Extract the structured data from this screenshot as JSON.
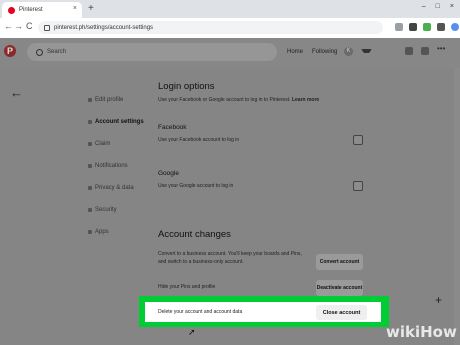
{
  "browser": {
    "tab_title": "Pinterest",
    "tab_close": "×",
    "new_tab": "+",
    "window_controls": [
      "–",
      "□",
      "×"
    ],
    "url": "pinterest.ph/settings/account-settings",
    "nav": {
      "back": "←",
      "forward": "→",
      "reload": "C"
    }
  },
  "header": {
    "logo": "P",
    "search_placeholder": "Search",
    "nav": [
      "Home",
      "Following"
    ],
    "avatar_letter": "K"
  },
  "back_arrow": "←",
  "sidebar": {
    "items": [
      {
        "label": "Edit profile",
        "icon": "pencil-icon"
      },
      {
        "label": "Account settings",
        "icon": "gear-icon"
      },
      {
        "label": "Claim",
        "icon": "globe-icon"
      },
      {
        "label": "Notifications",
        "icon": "bell-icon"
      },
      {
        "label": "Privacy & data",
        "icon": "lock-icon"
      },
      {
        "label": "Security",
        "icon": "shield-icon"
      },
      {
        "label": "Apps",
        "icon": "grid-icon"
      }
    ]
  },
  "login_options": {
    "title": "Login options",
    "desc_pre": "Use your Facebook or Google account to log in to Pinterest.",
    "learn_more": "Learn more",
    "facebook_title": "Facebook",
    "facebook_desc": "Use your Facebook account to log in",
    "google_title": "Google",
    "google_desc": "Use your Google account to log in"
  },
  "account_changes": {
    "title": "Account changes",
    "convert_desc": "Convert to a business account. You'll keep your boards and Pins, and switch to a business-only account.",
    "convert_btn": "Convert account",
    "hide_desc": "Hide your Pins and profile",
    "deactivate_btn": "Deactivate account",
    "delete_desc": "Delete your account and account data",
    "close_btn": "Close account"
  },
  "fab": "+",
  "watermark": "wikiHow"
}
